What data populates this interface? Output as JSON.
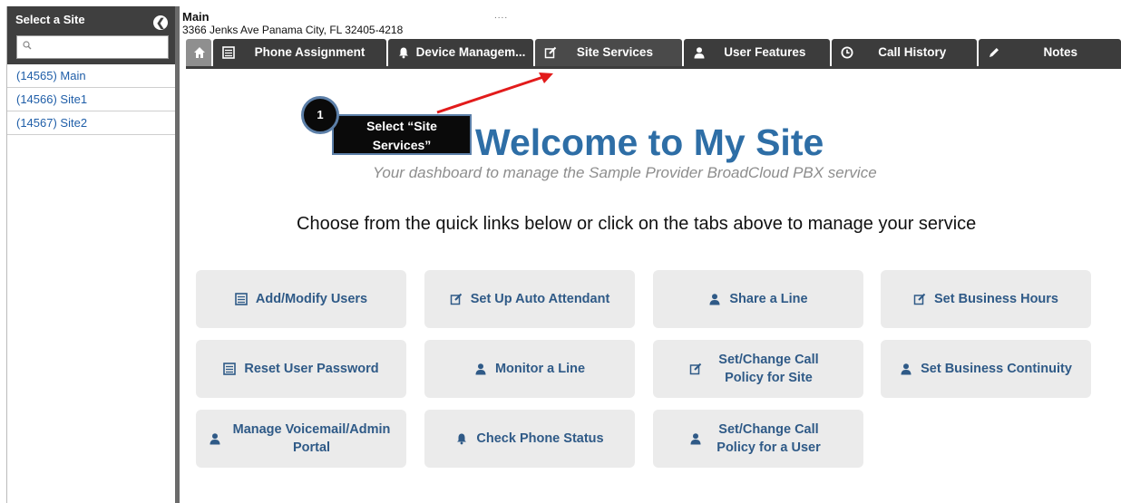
{
  "sidebar": {
    "title": "Select a Site",
    "search_placeholder": "",
    "items": [
      {
        "label": "(14565) Main"
      },
      {
        "label": "(14566) Site1"
      },
      {
        "label": "(14567) Site2"
      }
    ]
  },
  "header": {
    "site_name": "Main",
    "address": "3366 Jenks Ave Panama City, FL 32405-4218",
    "dots": "...."
  },
  "tabs": [
    {
      "label": "",
      "icon": "home-icon"
    },
    {
      "label": "Phone Assignment",
      "icon": "table-icon"
    },
    {
      "label": "Device Managem...",
      "icon": "bell-icon"
    },
    {
      "label": "Site Services",
      "icon": "checkbox-edit-icon"
    },
    {
      "label": "User Features",
      "icon": "user-icon"
    },
    {
      "label": "Call History",
      "icon": "clock-icon"
    },
    {
      "label": "Notes",
      "icon": "pencil-icon"
    }
  ],
  "main": {
    "welcome": "Welcome to My Site",
    "subtitle": "Your dashboard to manage the Sample Provider BroadCloud PBX service",
    "instructions": "Choose from the quick links below or click on the tabs above to manage your service"
  },
  "annotation": {
    "step": "1",
    "text_line1": "Select “Site",
    "text_line2": "Services”",
    "color": "#e21b1b"
  },
  "quick_links": [
    {
      "label": "Add/Modify Users",
      "icon": "table-icon"
    },
    {
      "label": "Set Up Auto Attendant",
      "icon": "checkbox-edit-icon"
    },
    {
      "label": "Share a Line",
      "icon": "user-icon"
    },
    {
      "label": "Set Business Hours",
      "icon": "checkbox-edit-icon"
    },
    {
      "label": "Reset User Password",
      "icon": "table-icon"
    },
    {
      "label": "Monitor a Line",
      "icon": "user-icon"
    },
    {
      "label": "Set/Change Call Policy for Site",
      "icon": "checkbox-edit-icon"
    },
    {
      "label": "Set Business Continuity",
      "icon": "user-icon"
    },
    {
      "label": "Manage Voicemail/Admin Portal",
      "icon": "user-icon"
    },
    {
      "label": "Check Phone Status",
      "icon": "bell-icon"
    },
    {
      "label": "Set/Change Call Policy for a User",
      "icon": "user-icon"
    }
  ],
  "colors": {
    "accent": "#2e6ea6",
    "tab_bg": "#3c3c3c",
    "link": "#2f5a87"
  }
}
